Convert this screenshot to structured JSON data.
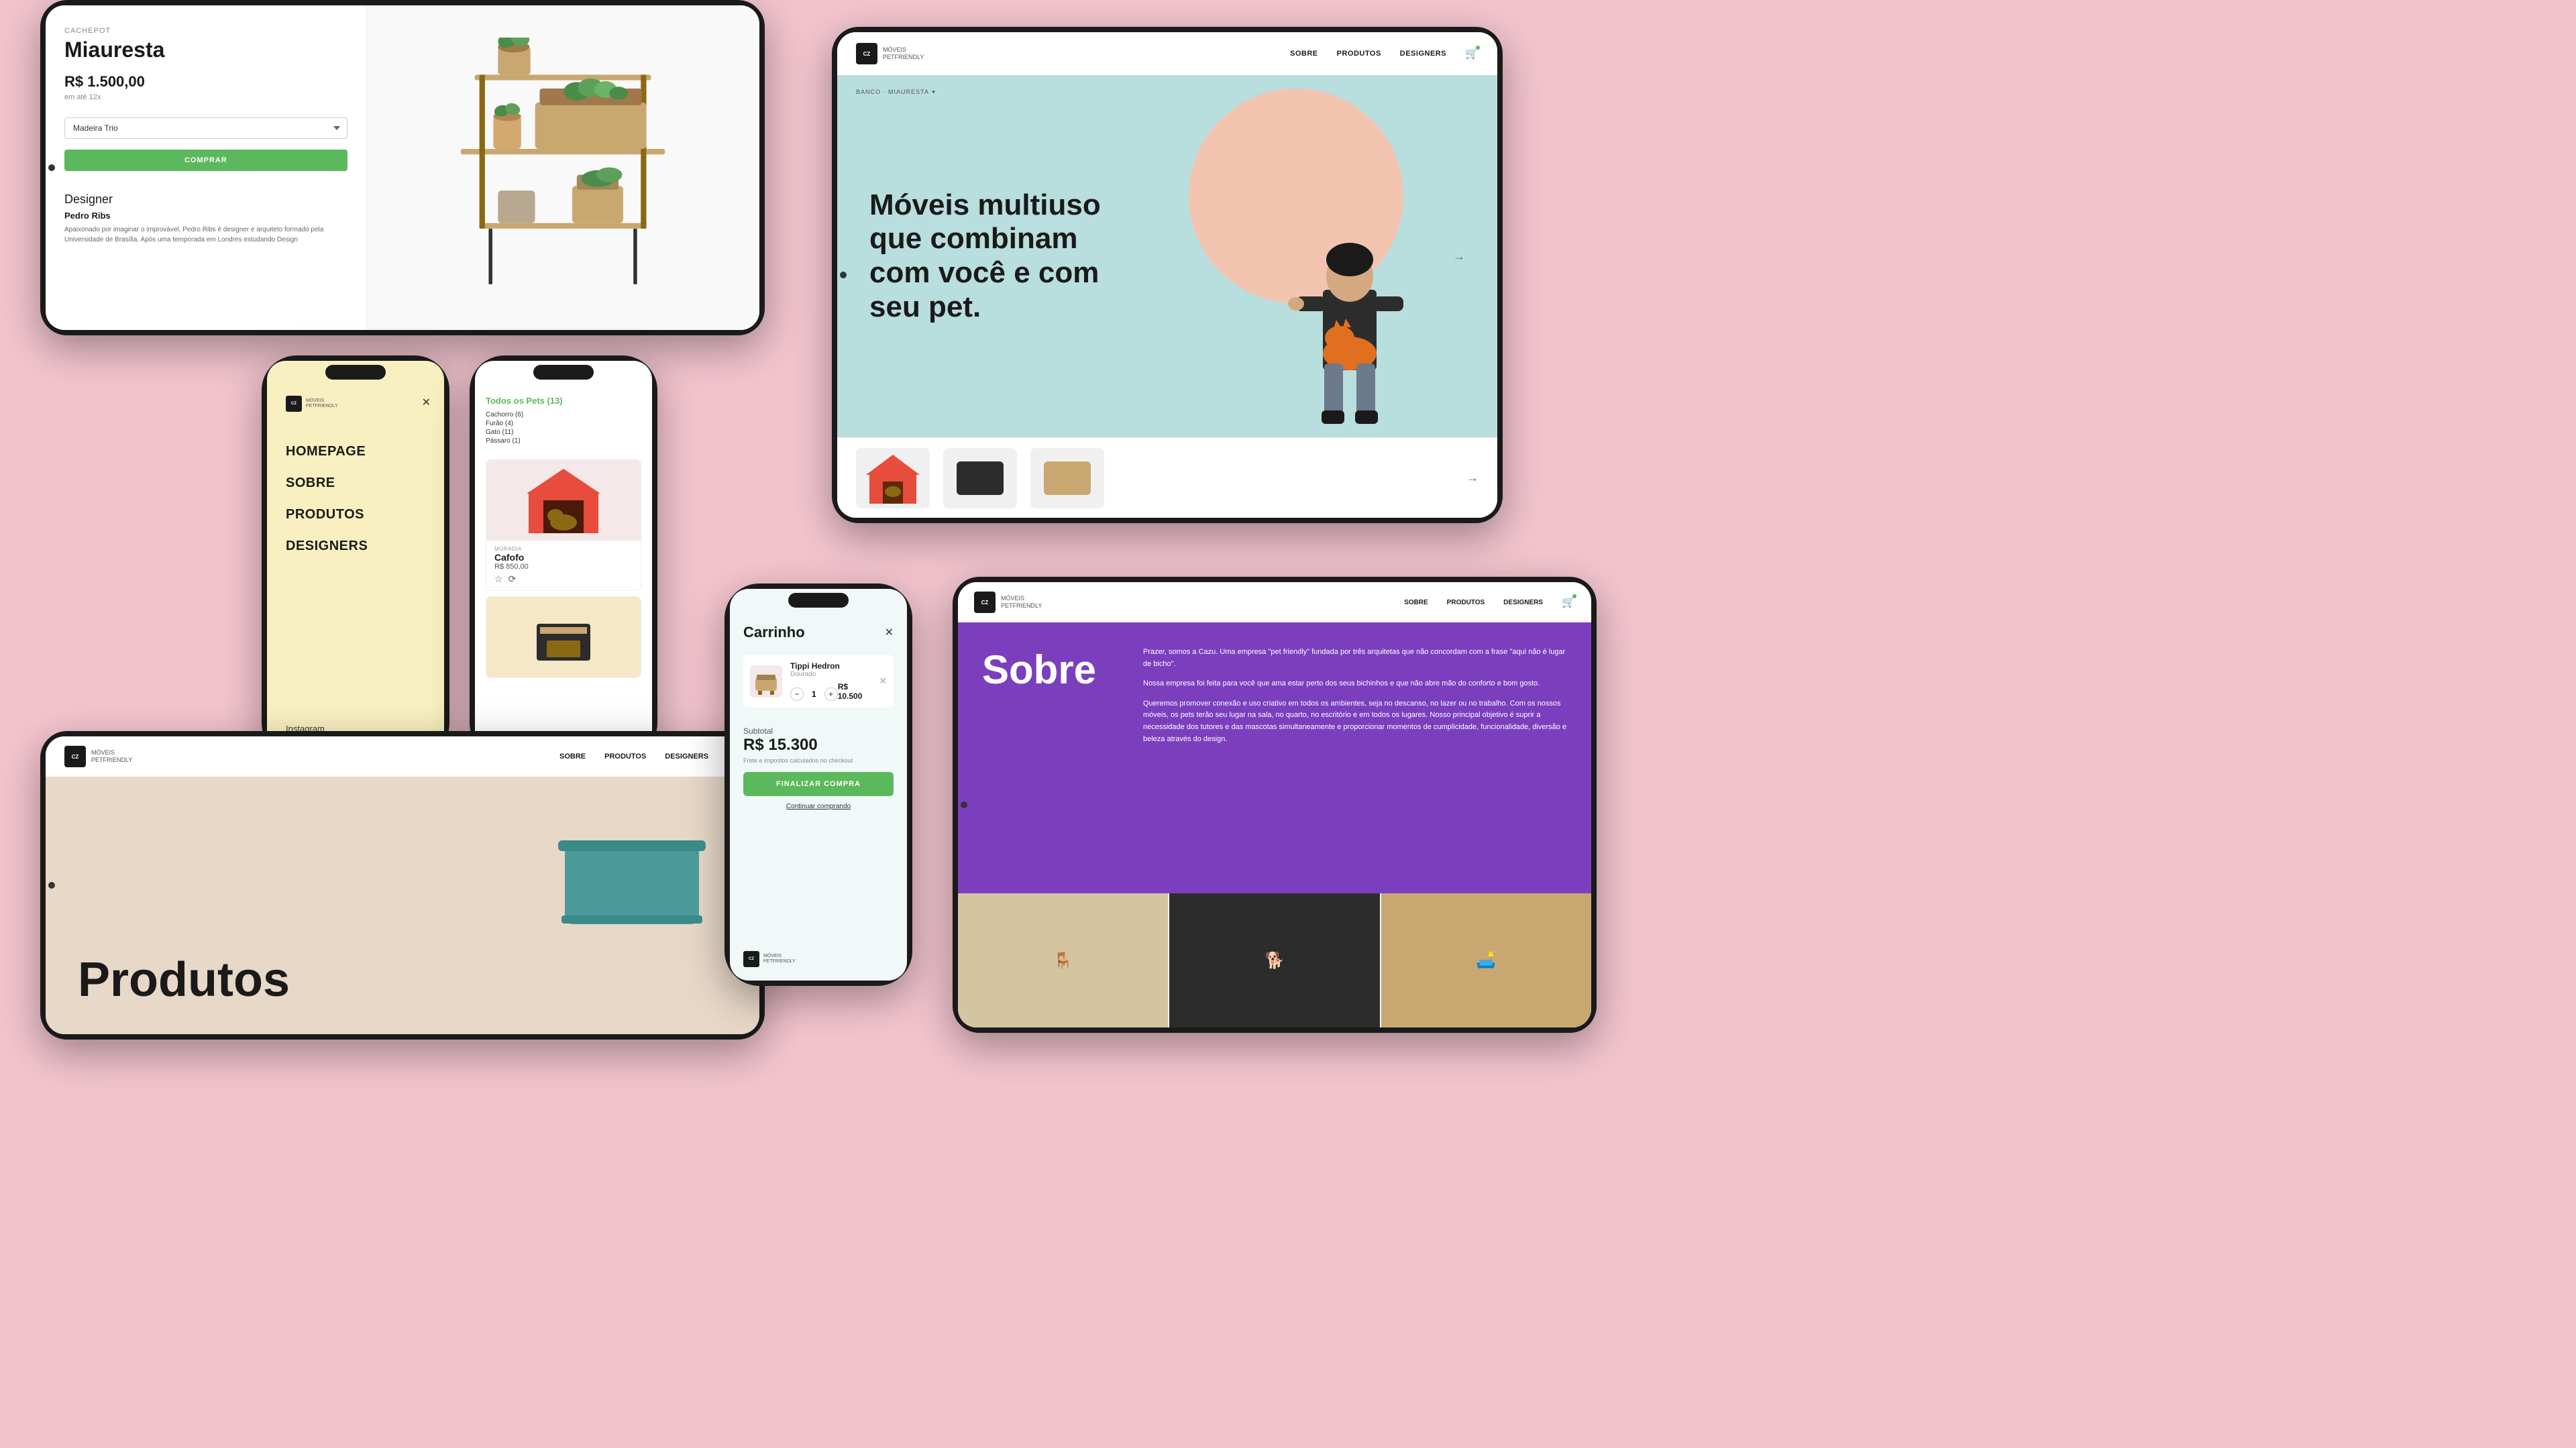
{
  "background_color": "#f2c4ce",
  "trio_label": "Trio",
  "devices": {
    "tablet_top_left": {
      "product": {
        "category": "CACHEPOT",
        "name": "Miauresta",
        "price": "R$ 1.500,00",
        "installment": "em até 12x",
        "variant_label": "Madeira Trio",
        "buy_button": "COMPRAR",
        "designer_label": "Designer",
        "designer_name": "Pedro Ribs",
        "designer_text": "Apaixonado por imaginar o improvável, Pedro Ribs é designer e arquiteto formado pela Universidade de Brasília. Após uma temporada em Londres estudando Design"
      }
    },
    "tablet_top_right": {
      "nav": {
        "logo_lines": [
          "CZ",
          "MÓVEIS",
          "PETFRIENDLY"
        ],
        "links": [
          "SOBRE",
          "PRODUTOS",
          "DESIGNERS"
        ],
        "cart_icon": "🛒"
      },
      "breadcrumb": "BANCO · MIAURESTA ✦",
      "heading": "Móveis multiuso que combinam com você e com seu pet.",
      "products": [
        {
          "color": "red_house",
          "label": "Red house"
        },
        {
          "color": "dark_box",
          "label": "Dark box"
        },
        {
          "color": "wood_shelf",
          "label": "Wood shelf"
        }
      ]
    },
    "phone_menu": {
      "logo_lines": [
        "CZ",
        "MÓVEIS",
        "PETFRIENDLY"
      ],
      "menu_items": [
        "HOMEPAGE",
        "SOBRE",
        "PRODUTOS",
        "DESIGNERS"
      ],
      "social": "Instagram"
    },
    "phone_products": {
      "filter_title": "Todos os Pets (13)",
      "filters": [
        {
          "name": "Cachorro (6)"
        },
        {
          "name": "Furão (4)"
        },
        {
          "name": "Gato (11)"
        },
        {
          "name": "Pássaro (1)"
        }
      ],
      "product": {
        "category": "MORADIA",
        "name": "Cafofo",
        "price": "R$ 850,00"
      }
    },
    "tablet_bottom_left": {
      "nav": {
        "logo_lines": [
          "CZ",
          "MÓVEIS",
          "PETFRIENDLY"
        ],
        "links": [
          "SOBRE",
          "PRODUTOS",
          "DESIGNERS"
        ],
        "cart_icon": "🛒"
      },
      "page_title": "Produtos"
    },
    "phone_cart": {
      "title": "Carrinho",
      "item": {
        "name": "Tippi Hedron",
        "variant": "Dourado",
        "qty": "1",
        "price": "R$ 10.500"
      },
      "subtotal_label": "Subtotal",
      "subtotal_value": "R$ 15.300",
      "tax_note": "Frete e impostos calculados no checkout",
      "checkout_button": "FINALIZAR COMPRA",
      "continue_link": "Continuar comprando",
      "logo_lines": [
        "CZ",
        "MÓVEIS",
        "PETFRIENDLY"
      ]
    },
    "tablet_bottom_right": {
      "nav": {
        "logo_lines": [
          "CZ",
          "MÓVEIS",
          "PETFRIENDLY"
        ],
        "links": [
          "SOBRE",
          "PRODUTOS",
          "DESIGNERS"
        ],
        "cart_icon": "🛒"
      },
      "page_title": "Sobre",
      "text1": "Prazer, somos a Cazu. Uma empresa \"pet friendly\" fundada por três arquitetas que não concordam com a frase \"aqui não é lugar de bicho\".",
      "text2": "Nossa empresa foi feita para você que ama estar perto dos seus bichinhos e que não abre mão do conforto e bom gosto.",
      "text3": "Queremos promover conexão e uso criativo em todos os ambientes, seja no descanso, no lazer ou no trabalho. Com os nossos móveis, os pets terão seu lugar na sala, no quarto, no escritório e em todos os lugares. Nosso principal objetivo é suprir a necessidade dos tutores e das mascotas simultaneamente e proporcionar momentos de cumplicidade, funcionalidade, diversão e beleza através do design."
    }
  }
}
